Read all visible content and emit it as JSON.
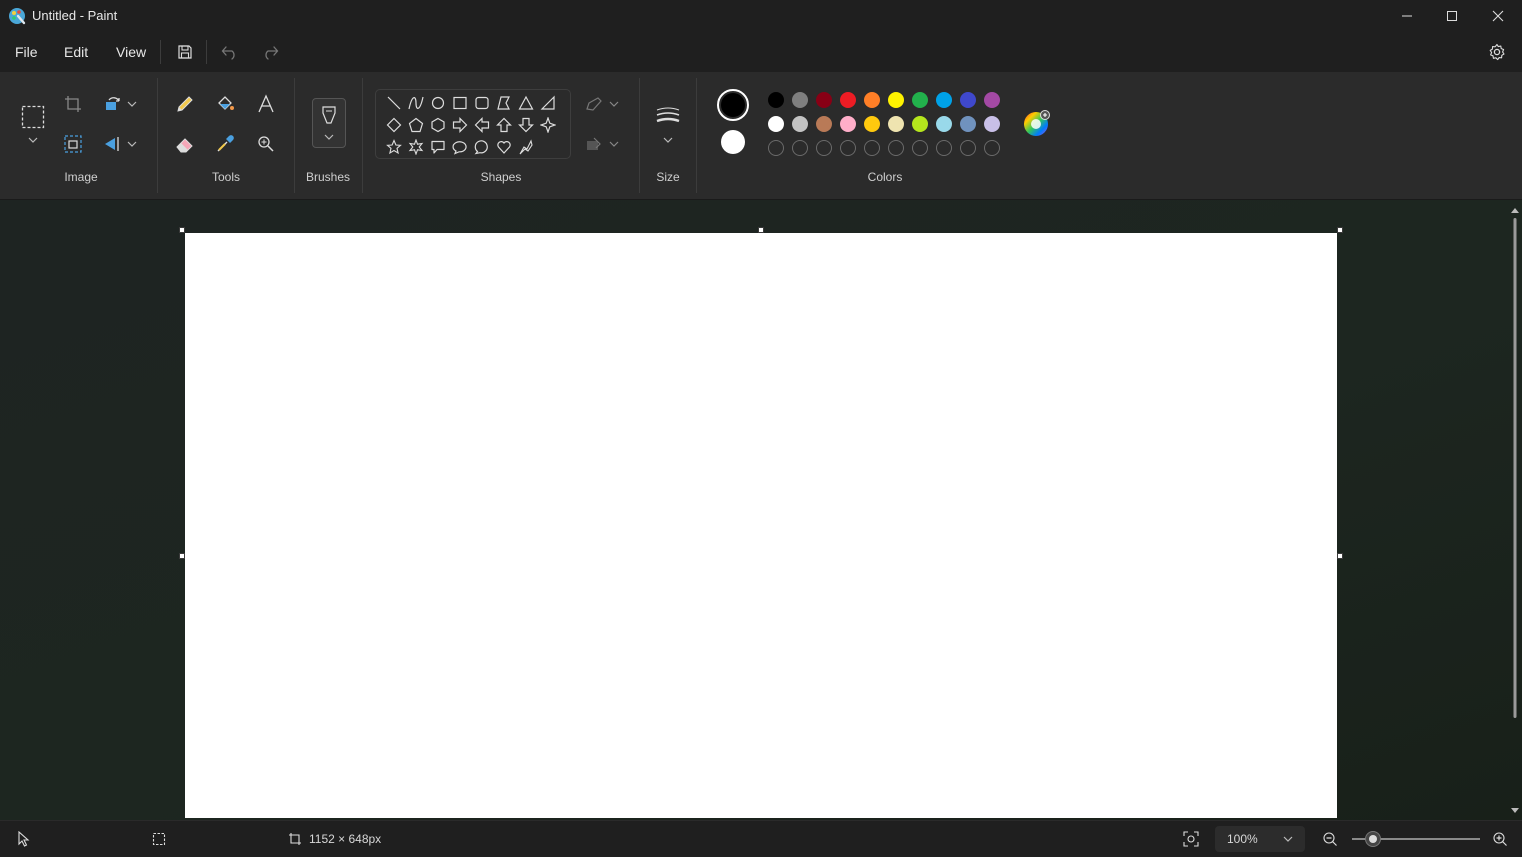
{
  "window": {
    "title": "Untitled - Paint"
  },
  "menu": {
    "file": "File",
    "edit": "Edit",
    "view": "View"
  },
  "ribbon": {
    "groups": {
      "image": "Image",
      "tools": "Tools",
      "brushes": "Brushes",
      "shapes": "Shapes",
      "size": "Size",
      "colors": "Colors"
    }
  },
  "colors": {
    "primary": "#000000",
    "secondary": "#ffffff",
    "row1": [
      "#000000",
      "#7f7f7f",
      "#880015",
      "#ed1c24",
      "#ff7f27",
      "#fff200",
      "#22b14c",
      "#00a2e8",
      "#3f48cc",
      "#a349a4"
    ],
    "row2": [
      "#ffffff",
      "#c3c3c3",
      "#b97a57",
      "#ffaec9",
      "#ffc90e",
      "#efe4b0",
      "#b5e61d",
      "#99d9ea",
      "#7092be",
      "#c8bfe7"
    ],
    "custom_slots": 10
  },
  "status": {
    "canvas_size": "1152 × 648px",
    "zoom": "100%"
  }
}
